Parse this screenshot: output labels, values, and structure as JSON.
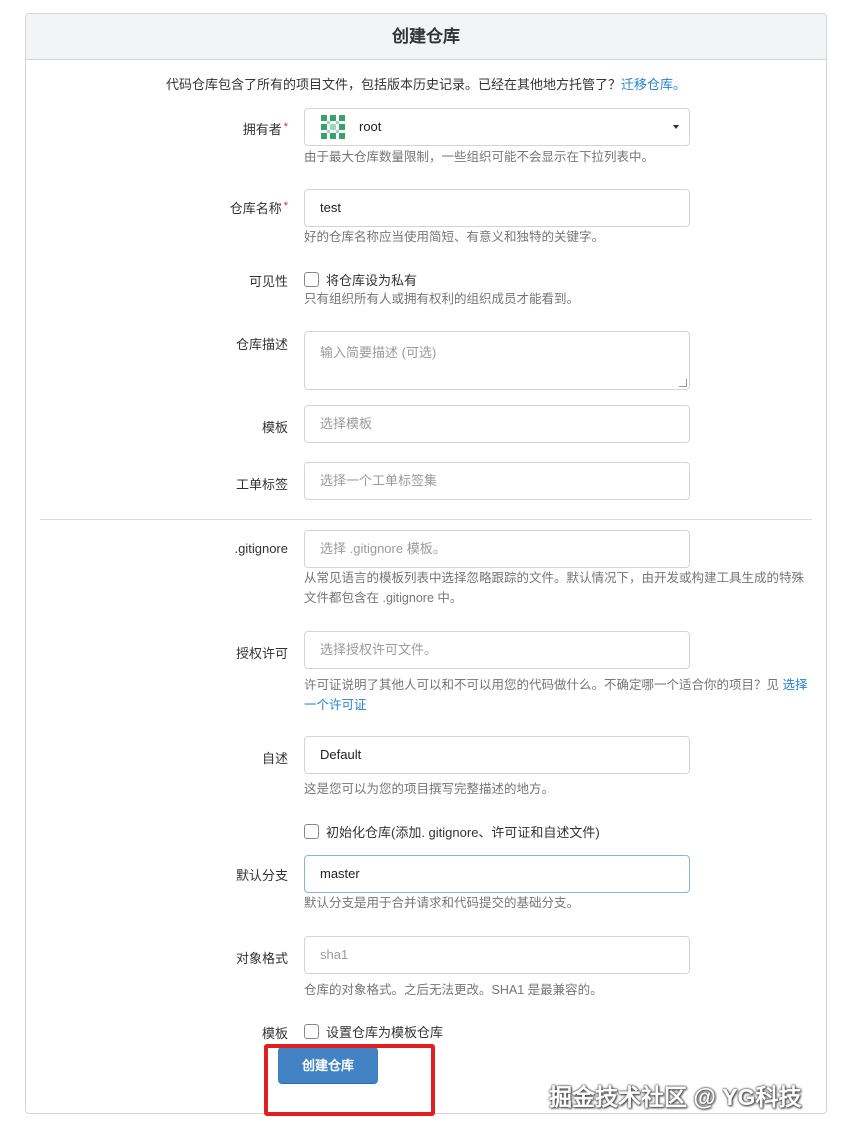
{
  "header": {
    "title": "创建仓库"
  },
  "intro": {
    "text": "代码仓库包含了所有的项目文件，包括版本历史记录。已经在其他地方托管了？",
    "link": "迁移仓库。"
  },
  "owner": {
    "label": "拥有者",
    "required_mark": "*",
    "value": "root",
    "help": "由于最大仓库数量限制，一些组织可能不会显示在下拉列表中。"
  },
  "repo_name": {
    "label": "仓库名称",
    "required_mark": "*",
    "value": "test",
    "help": "好的仓库名称应当使用简短、有意义和独特的关键字。"
  },
  "visibility": {
    "label": "可见性",
    "checkbox": "将仓库设为私有",
    "help": "只有组织所有人或拥有权利的组织成员才能看到。"
  },
  "description": {
    "label": "仓库描述",
    "placeholder": "输入简要描述 (可选)"
  },
  "template": {
    "label": "模板",
    "placeholder": "选择模板"
  },
  "issue_labels": {
    "label": "工单标签",
    "placeholder": "选择一个工单标签集"
  },
  "gitignore": {
    "label": ".gitignore",
    "placeholder": "选择 .gitignore 模板。",
    "help": "从常见语言的模板列表中选择忽略跟踪的文件。默认情况下，由开发或构建工具生成的特殊文件都包含在 .gitignore 中。"
  },
  "license": {
    "label": "授权许可",
    "placeholder": "选择授权许可文件。",
    "help": "许可证说明了其他人可以和不可以用您的代码做什么。不确定哪一个适合你的项目？见 ",
    "help_link": "选择一个许可证"
  },
  "readme": {
    "label": "自述",
    "value": "Default",
    "help": "这是您可以为您的项目撰写完整描述的地方。"
  },
  "init": {
    "checkbox": "初始化仓库(添加. gitignore、许可证和自述文件)"
  },
  "default_branch": {
    "label": "默认分支",
    "value": "master",
    "help": "默认分支是用于合并请求和代码提交的基础分支。"
  },
  "object_format": {
    "label": "对象格式",
    "value": "sha1",
    "help": "仓库的对象格式。之后无法更改。SHA1 是最兼容的。"
  },
  "template_repo": {
    "label": "模板",
    "checkbox": "设置仓库为模板仓库"
  },
  "submit": {
    "label": "创建仓库"
  },
  "watermark": "掘金技术社区 @ YG科技",
  "colors": {
    "primary": "#4183c4",
    "link": "#2185d0",
    "highlight": "#e02020",
    "required": "#db2828"
  }
}
